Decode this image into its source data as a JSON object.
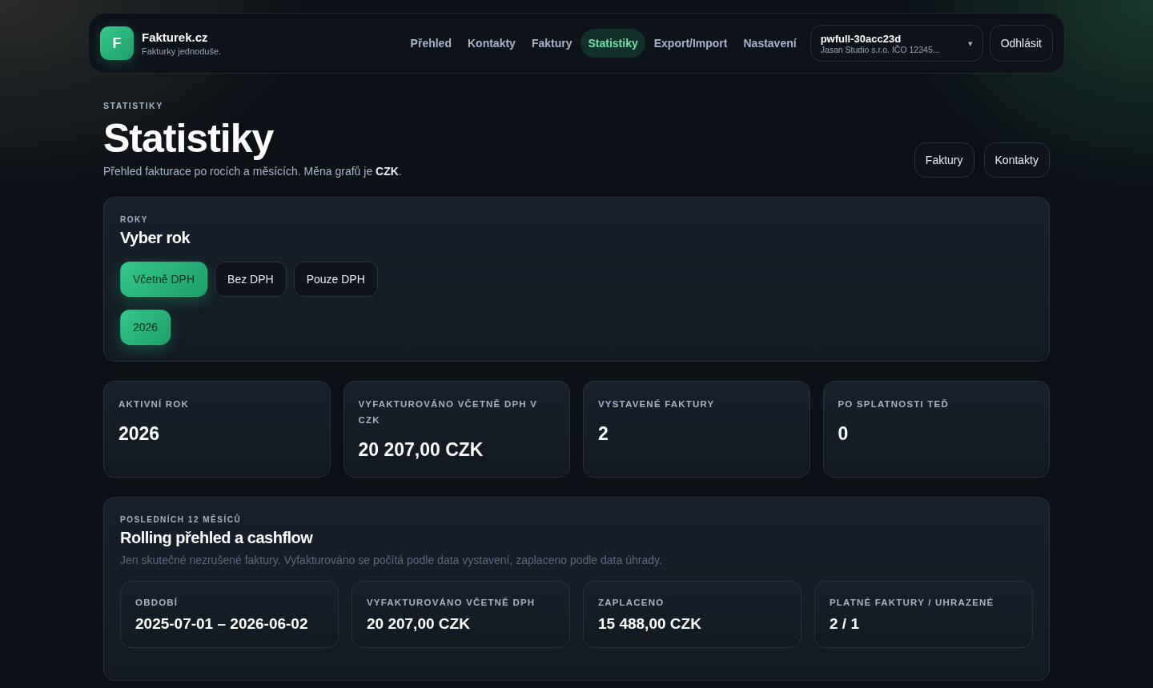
{
  "brand": {
    "logo": "F",
    "name": "Fakturek.cz",
    "tagline": "Fakturky jednoduše."
  },
  "nav": [
    {
      "label": "Přehled",
      "selected": false
    },
    {
      "label": "Kontakty",
      "selected": false
    },
    {
      "label": "Faktury",
      "selected": false
    },
    {
      "label": "Statistiky",
      "selected": true
    },
    {
      "label": "Export/Import",
      "selected": false
    },
    {
      "label": "Nastavení",
      "selected": false
    }
  ],
  "account": {
    "name": "pwfull-30acc23d",
    "company": "Jasan Studio s.r.o. IČO 12345...",
    "caret": "▾"
  },
  "logout": "Odhlásit",
  "page": {
    "eyebrow": "STATISTIKY",
    "title": "Statistiky",
    "subtitle": "Přehled fakturace po rocích a měsících. Měna grafů je **CZK**.",
    "actions": [
      "Faktury",
      "Kontakty"
    ]
  },
  "years_panel": {
    "eyebrow": "ROKY",
    "title": "Vyber rok",
    "vat_modes": [
      {
        "label": "Včetně DPH",
        "selected": true
      },
      {
        "label": "Bez DPH",
        "selected": false
      },
      {
        "label": "Pouze DPH",
        "selected": false
      }
    ],
    "years": [
      {
        "label": "2026",
        "selected": true
      }
    ]
  },
  "stats": [
    {
      "label": "AKTIVNÍ ROK",
      "value": "2026"
    },
    {
      "label": "VYFAKTUROVÁNO VČETNĚ DPH V CZK",
      "value": "20 207,00 CZK"
    },
    {
      "label": "VYSTAVENÉ FAKTURY",
      "value": "2"
    },
    {
      "label": "PO SPLATNOSTI TEĎ",
      "value": "0"
    }
  ],
  "rolling": {
    "eyebrow": "POSLEDNÍCH 12 MĚSÍCŮ",
    "title": "Rolling přehled a cashflow",
    "note": "Jen skutečné nezrušené faktury. Vyfakturováno se počítá podle data vystavení, zaplaceno podle data úhrady.",
    "stats": [
      {
        "label": "OBDOBÍ",
        "value": "2025-07-01 – 2026-06-02"
      },
      {
        "label": "VYFAKTUROVÁNO VČETNĚ DPH",
        "value": "20 207,00 CZK"
      },
      {
        "label": "ZAPLACENO",
        "value": "15 488,00 CZK"
      },
      {
        "label": "PLATNÉ FAKTURY / UHRAZENÉ",
        "value": "2 / 1"
      }
    ]
  }
}
